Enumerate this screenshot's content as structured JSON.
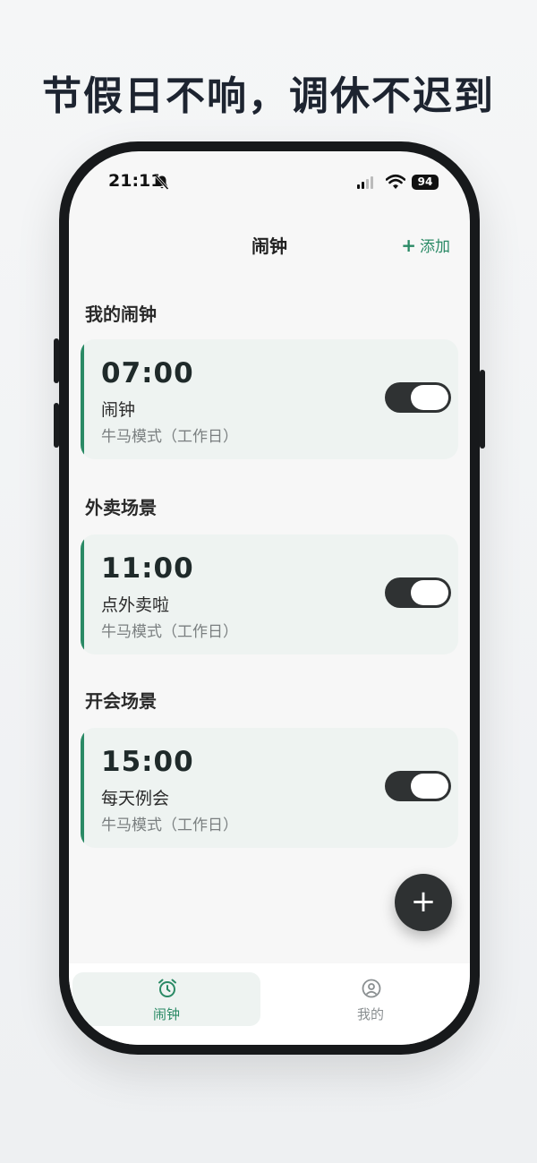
{
  "promo": {
    "headline": "节假日不响，调休不迟到"
  },
  "status_bar": {
    "time": "21:11",
    "battery": "94",
    "icons": [
      "bell-slash-icon",
      "signal-icon",
      "wifi-icon",
      "battery-icon"
    ]
  },
  "header": {
    "title": "闹钟",
    "add_label": "添加",
    "add_icon": "plus-icon"
  },
  "sections": [
    {
      "title": "我的闹钟",
      "alarms": [
        {
          "time": "07:00",
          "label": "闹钟",
          "mode": "牛马模式（工作日）",
          "enabled": true
        }
      ]
    },
    {
      "title": "外卖场景",
      "alarms": [
        {
          "time": "11:00",
          "label": "点外卖啦",
          "mode": "牛马模式（工作日）",
          "enabled": true
        }
      ]
    },
    {
      "title": "开会场景",
      "alarms": [
        {
          "time": "15:00",
          "label": "每天例会",
          "mode": "牛马模式（工作日）",
          "enabled": true
        }
      ]
    }
  ],
  "fab": {
    "icon": "plus-icon",
    "symbol": "+"
  },
  "tabs": [
    {
      "label": "闹钟",
      "icon": "alarm-clock-icon",
      "active": true
    },
    {
      "label": "我的",
      "icon": "user-circle-icon",
      "active": false
    }
  ],
  "colors": {
    "accent": "#2a8a65",
    "card_background": "#eef3f1",
    "toggle_on": "#2f3233",
    "page_background": "#f7f7f7"
  }
}
